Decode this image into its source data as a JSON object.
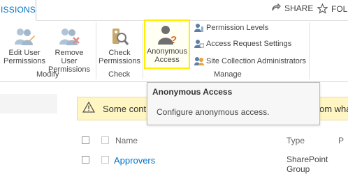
{
  "tabs": {
    "active_label": "ISSIONS"
  },
  "header": {
    "share_label": "SHARE",
    "follow_label": "FOLL"
  },
  "ribbon": {
    "edit_user_permissions": "Edit User\nPermissions",
    "remove_user_permissions": "Remove User\nPermissions",
    "modify_group": "Modify",
    "check_permissions": "Check\nPermissions",
    "check_group": "Check",
    "anonymous_access": "Anonymous\nAccess",
    "permission_levels": "Permission Levels",
    "access_request_settings": "Access Request Settings",
    "site_collection_administrators": "Site Collection Administrators",
    "manage_group": "Manage"
  },
  "tooltip": {
    "title": "Anonymous Access",
    "description": "Configure anonymous access."
  },
  "warning": {
    "text_start": "Some cont",
    "text_end": "om wha"
  },
  "table": {
    "columns": {
      "name": "Name",
      "type": "Type",
      "extra": "P"
    },
    "rows": [
      {
        "name": "Approvers",
        "type_line1": "SharePoint",
        "type_line2": "Group",
        "extra": ""
      }
    ]
  },
  "colors": {
    "accent": "#0072c6",
    "highlight": "#ffee00",
    "warning_bg": "#fff6c4"
  }
}
